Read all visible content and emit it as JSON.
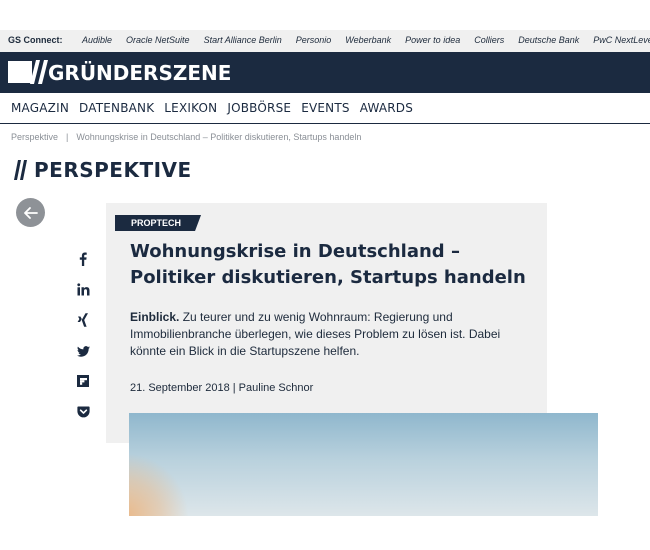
{
  "gs_connect": {
    "label": "GS Connect:",
    "links": [
      "Audible",
      "Oracle NetSuite",
      "Start Alliance Berlin",
      "Personio",
      "Weberbank",
      "Power to idea",
      "Colliers",
      "Deutsche Bank",
      "PwC NextLevel"
    ]
  },
  "logo": {
    "text": "GRÜNDERSZENE"
  },
  "nav": {
    "items": [
      "MAGAZIN",
      "DATENBANK",
      "LEXIKON",
      "JOBBÖRSE",
      "EVENTS",
      "AWARDS"
    ]
  },
  "breadcrumb": {
    "section": "Perspektive",
    "separator": "|",
    "current": "Wohnungskrise in Deutschland – Politiker diskutieren, Startups handeln"
  },
  "section_title": "PERSPEKTIVE",
  "share_icons": [
    "facebook-icon",
    "linkedin-icon",
    "xing-icon",
    "twitter-icon",
    "flipboard-icon",
    "pocket-icon"
  ],
  "article": {
    "tag": "PROPTECH",
    "headline_line1": "Wohnungskrise in Deutschland –",
    "headline_line2": "Politiker diskutieren, Startups handeln",
    "intro_lead": "Einblick.",
    "intro_text": " Zu teurer und zu wenig Wohnraum: Regierung und Immobilienbranche überlegen, wie dieses Problem zu lösen ist. Dabei könnte ein Blick in die Startupszene helfen.",
    "date": "21. September 2018",
    "byline_sep": " | ",
    "author": "Pauline Schnor"
  },
  "colors": {
    "brand_navy": "#1b2a40",
    "card_bg": "#f0f0f0",
    "muted": "#8a8f96"
  }
}
